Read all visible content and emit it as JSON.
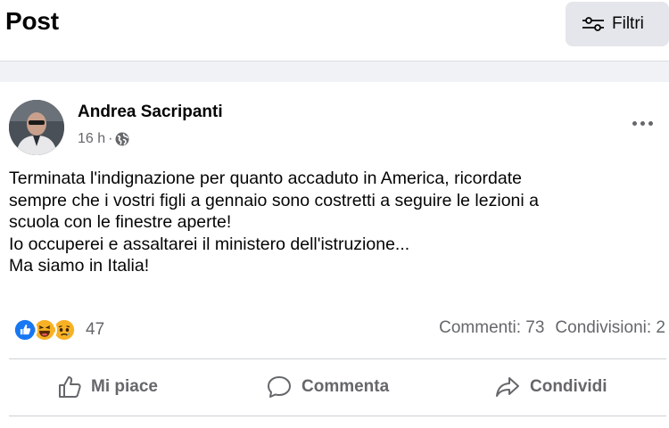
{
  "header": {
    "title": "Post",
    "filter_label": "Filtri",
    "filter_icon": "sliders-icon"
  },
  "post": {
    "author": "Andrea Sacripanti",
    "time": "16 h",
    "separator": "·",
    "privacy_icon": "globe-icon",
    "text_lines": [
      "Terminata l'indignazione per quanto accaduto in America, ricordate",
      "sempre che i vostri figli a gennaio sono costretti a seguire le lezioni a",
      "scuola con le finestre aperte!",
      "Io occuperei e assaltarei il ministero dell'istruzione...",
      "Ma siamo in Italia!"
    ],
    "reactions": {
      "icons": [
        "like-reaction-icon",
        "haha-reaction-icon",
        "sad-reaction-icon"
      ],
      "count": "47"
    },
    "stats": {
      "comments": "Commenti: 73",
      "shares": "Condivisioni: 2"
    },
    "actions": {
      "like": "Mi piace",
      "comment": "Commenta",
      "share": "Condividi"
    }
  },
  "colors": {
    "secondary_text": "#65676b",
    "like_blue": "#1877f2",
    "reaction_yellow": "#f7b125",
    "divider": "#ced0d4",
    "filter_bg": "#e4e6eb"
  }
}
